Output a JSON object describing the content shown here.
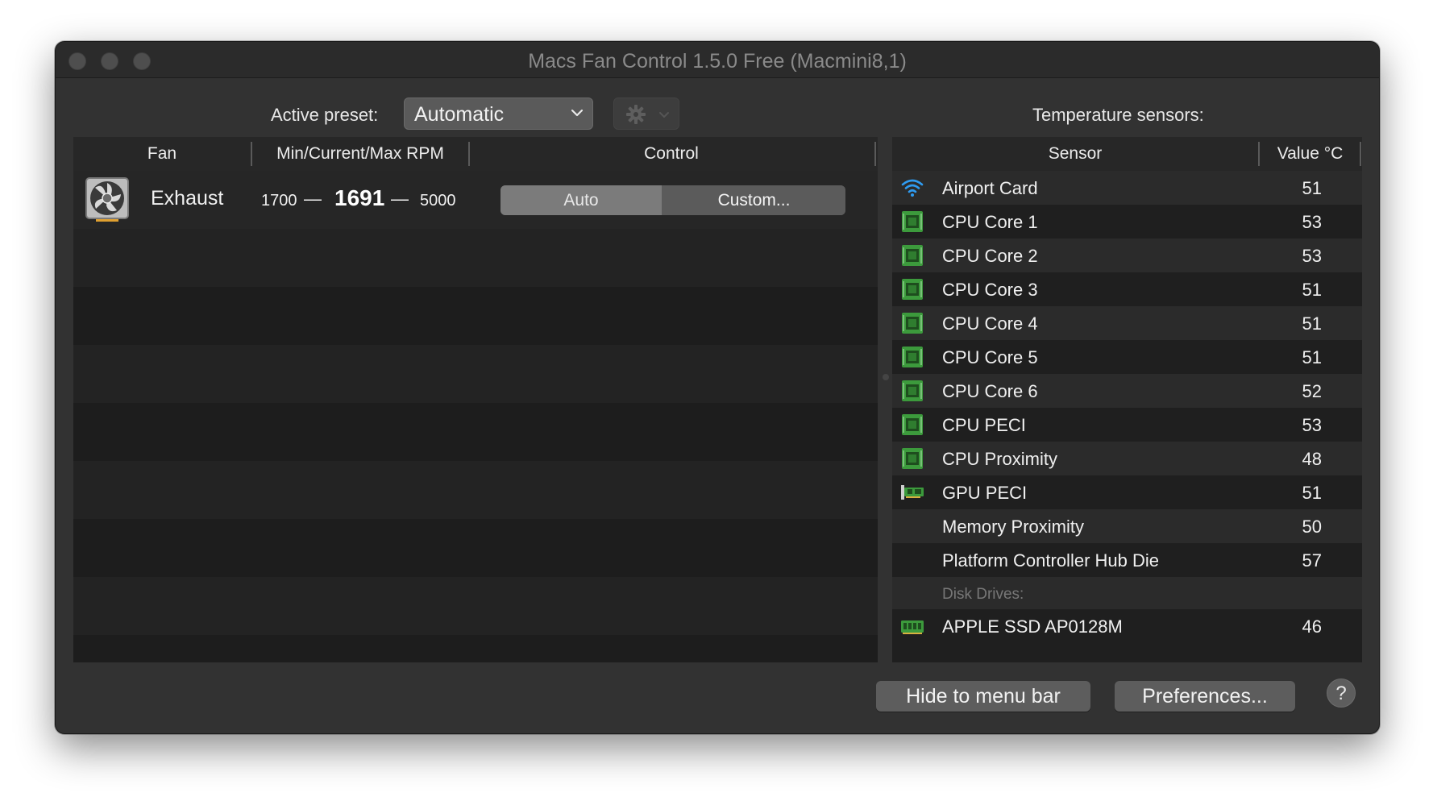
{
  "window": {
    "title": "Macs Fan Control 1.5.0 Free (Macmini8,1)"
  },
  "toolbar": {
    "preset_label": "Active preset:",
    "preset_value": "Automatic",
    "settings_icon": "gear-icon",
    "temp_title": "Temperature sensors:"
  },
  "fans": {
    "columns": [
      "Fan",
      "Min/Current/Max RPM",
      "Control"
    ],
    "rows": [
      {
        "name": "Exhaust",
        "min": "1700",
        "current": "1691",
        "max": "5000",
        "dash": "—",
        "auto_label": "Auto",
        "custom_label": "Custom...",
        "selected": "Auto",
        "icon": "fan-icon"
      }
    ]
  },
  "sensors": {
    "columns": [
      "Sensor",
      "Value °C"
    ],
    "rows": [
      {
        "name": "Airport Card",
        "value": "51",
        "icon": "wifi-icon"
      },
      {
        "name": "CPU Core 1",
        "value": "53",
        "icon": "cpu-chip-icon"
      },
      {
        "name": "CPU Core 2",
        "value": "53",
        "icon": "cpu-chip-icon"
      },
      {
        "name": "CPU Core 3",
        "value": "51",
        "icon": "cpu-chip-icon"
      },
      {
        "name": "CPU Core 4",
        "value": "51",
        "icon": "cpu-chip-icon"
      },
      {
        "name": "CPU Core 5",
        "value": "51",
        "icon": "cpu-chip-icon"
      },
      {
        "name": "CPU Core 6",
        "value": "52",
        "icon": "cpu-chip-icon"
      },
      {
        "name": "CPU PECI",
        "value": "53",
        "icon": "cpu-chip-icon"
      },
      {
        "name": "CPU Proximity",
        "value": "48",
        "icon": "cpu-chip-icon"
      },
      {
        "name": "GPU PECI",
        "value": "51",
        "icon": "gpu-card-icon"
      },
      {
        "name": "Memory Proximity",
        "value": "50",
        "icon": ""
      },
      {
        "name": "Platform Controller Hub Die",
        "value": "57",
        "icon": ""
      }
    ],
    "group_label": "Disk Drives:",
    "disk_rows": [
      {
        "name": "APPLE SSD AP0128M",
        "value": "46",
        "icon": "ssd-icon"
      }
    ]
  },
  "footer": {
    "hide_label": "Hide to menu bar",
    "prefs_label": "Preferences...",
    "help_label": "?"
  },
  "colors": {
    "window_bg": "#323232",
    "chip_green": "#3c9a3c",
    "wifi_blue": "#2f9bf0"
  }
}
